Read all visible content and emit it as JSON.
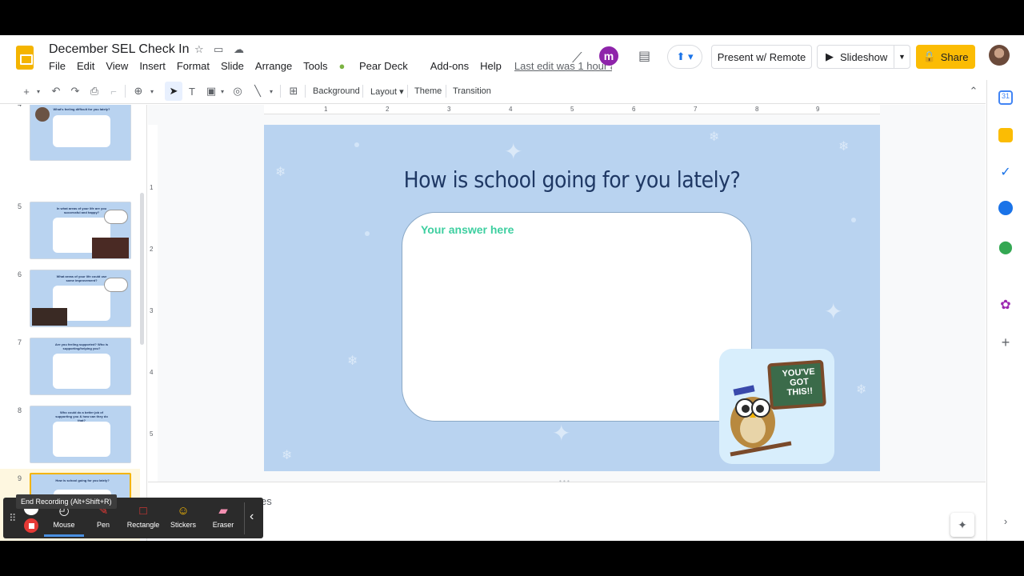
{
  "header": {
    "title": "December SEL Check In",
    "menu": [
      "File",
      "Edit",
      "View",
      "Insert",
      "Format",
      "Slide",
      "Arrange",
      "Tools",
      "Pear Deck",
      "Add-ons",
      "Help"
    ],
    "last_edit": "Last edit was 1 hour ago",
    "present_remote": "Present w/ Remote",
    "slideshow": "Slideshow",
    "share": "Share"
  },
  "toolbar": {
    "background": "Background",
    "layout": "Layout",
    "theme": "Theme",
    "transition": "Transition"
  },
  "filmstrip": {
    "slides": [
      {
        "number": "4",
        "question": "What's feeling difficult for you lately?"
      },
      {
        "number": "5",
        "question": "In what areas of your life are you successful and happy?"
      },
      {
        "number": "6",
        "question": "What areas of your life could use some improvement?"
      },
      {
        "number": "7",
        "question": "Are you feeling supported? Who is supporting/helping you?"
      },
      {
        "number": "8",
        "question": "Who could do a better job of supporting you & how can they do that?"
      },
      {
        "number": "9",
        "question": "How is school going for you lately?"
      }
    ],
    "selected": "9"
  },
  "ruler": {
    "horizontal": [
      "1",
      "2",
      "3",
      "4",
      "5",
      "6",
      "7",
      "8",
      "9"
    ],
    "vertical": [
      "1",
      "2",
      "3",
      "4",
      "5"
    ]
  },
  "slide": {
    "title": "How is school going for you lately?",
    "answer_placeholder": "Your answer here",
    "sticker_text": "YOU'VE GOT THIS!!"
  },
  "notes": {
    "text": "es"
  },
  "recorder": {
    "tooltip": "End Recording (Alt+Shift+R)",
    "tools": [
      "Mouse",
      "Pen",
      "Rectangle",
      "Stickers",
      "Eraser"
    ]
  },
  "colors": {
    "accent": "#fbbc04",
    "slide_bg": "#b9d3f0",
    "title": "#1f3864",
    "answer": "#3ecfa0"
  }
}
